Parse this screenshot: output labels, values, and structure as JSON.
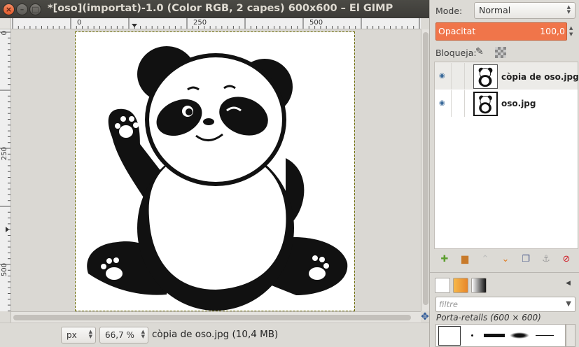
{
  "window": {
    "title": "*[oso](importat)-1.0 (Color RGB, 2 capes) 600x600 – El GIMP",
    "close_glyph": "×",
    "min_glyph": "–",
    "max_glyph": "□"
  },
  "rulers": {
    "h_labels": [
      "0",
      "250",
      "500"
    ],
    "v_labels": [
      "0",
      "250",
      "500"
    ]
  },
  "status": {
    "unit": "px",
    "zoom": "66,7 %",
    "info": "còpia de oso.jpg (10,4 MB)"
  },
  "layers_panel": {
    "mode_label": "Mode:",
    "mode_value": "Normal",
    "opacity_label": "Opacitat",
    "opacity_value": "100,0",
    "opacity_fraction": 1.0,
    "lock_label": "Bloqueja:",
    "layers": [
      {
        "name": "còpia de oso.jpg",
        "visible": true,
        "selected": true
      },
      {
        "name": "oso.jpg",
        "visible": true,
        "selected": false
      }
    ],
    "buttons": [
      {
        "icon": "new-layer-icon",
        "glyph": "✚",
        "color": "#5c9e2e"
      },
      {
        "icon": "new-layer-group-icon",
        "glyph": "▆",
        "color": "#c87a2a"
      },
      {
        "icon": "raise-layer-icon",
        "glyph": "⌃",
        "color": "#bcbcbc"
      },
      {
        "icon": "lower-layer-icon",
        "glyph": "⌄",
        "color": "#e07b20"
      },
      {
        "icon": "duplicate-layer-icon",
        "glyph": "❐",
        "color": "#4a5a8a"
      },
      {
        "icon": "anchor-layer-icon",
        "glyph": "⚓",
        "color": "#a0a0a0"
      },
      {
        "icon": "delete-layer-icon",
        "glyph": "⊘",
        "color": "#d0202a"
      }
    ]
  },
  "brushes_panel": {
    "filter_placeholder": "filtre",
    "title": "Porta-retalls (600 × 600)"
  },
  "colors": {
    "accent": "#f0754a",
    "titlebar": "#3c3b37"
  }
}
